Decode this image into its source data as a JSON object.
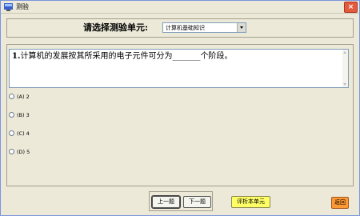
{
  "window": {
    "title": "测验"
  },
  "header": {
    "select_label": "请选择测验单元:",
    "unit_value": "计算机基础知识"
  },
  "question": {
    "number": "1.",
    "text": "计算机的发展按其所采用的电子元件可分为_______个阶段。"
  },
  "options": [
    {
      "label": "(A) 2"
    },
    {
      "label": "(B) 3"
    },
    {
      "label": "(C) 4"
    },
    {
      "label": "(D) 5"
    }
  ],
  "buttons": {
    "prev": "上一题",
    "next": "下一题",
    "analyze": "评析本单元",
    "back": "返回"
  },
  "colors": {
    "analyze_bg": "#ffff66",
    "back_bg": "#ff9933",
    "window_bg": "#ece9d8"
  }
}
